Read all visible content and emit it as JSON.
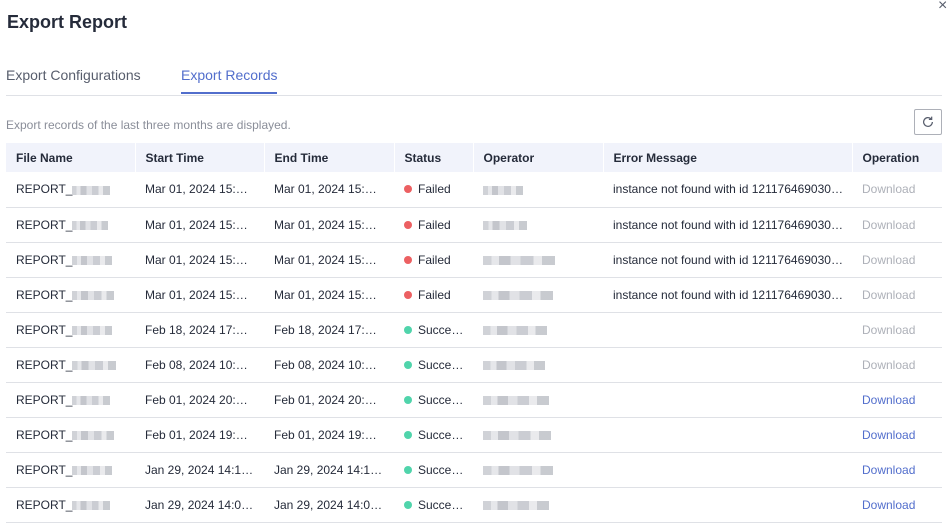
{
  "dialog": {
    "title": "Export Report",
    "close_glyph": "×"
  },
  "tabs": [
    {
      "label": "Export Configurations",
      "active": false
    },
    {
      "label": "Export Records",
      "active": true
    }
  ],
  "notice": "Export records of the last three months are displayed.",
  "refresh_icon": "refresh-icon",
  "colors": {
    "accent": "#526ecc",
    "failed": "#ec6062",
    "success": "#50d4ab",
    "disabled": "#adb0b8"
  },
  "table": {
    "columns": [
      "File Name",
      "Start Time",
      "End Time",
      "Status",
      "Operator",
      "Error Message",
      "Operation"
    ],
    "rows": [
      {
        "file": "REPORT_",
        "start": "Mar 01, 2024 15:…",
        "end": "Mar 01, 2024 15:…",
        "status": "Failed",
        "status_type": "failed",
        "error": "instance not found with id 121176469030…",
        "op": "Download",
        "op_enabled": false
      },
      {
        "file": "REPORT_",
        "start": "Mar 01, 2024 15:…",
        "end": "Mar 01, 2024 15:…",
        "status": "Failed",
        "status_type": "failed",
        "error": "instance not found with id 121176469030…",
        "op": "Download",
        "op_enabled": false
      },
      {
        "file": "REPORT_",
        "start": "Mar 01, 2024 15:…",
        "end": "Mar 01, 2024 15:…",
        "status": "Failed",
        "status_type": "failed",
        "error": "instance not found with id 121176469030…",
        "op": "Download",
        "op_enabled": false
      },
      {
        "file": "REPORT_",
        "start": "Mar 01, 2024 15:…",
        "end": "Mar 01, 2024 15:…",
        "status": "Failed",
        "status_type": "failed",
        "error": "instance not found with id 121176469030…",
        "op": "Download",
        "op_enabled": false
      },
      {
        "file": "REPORT_",
        "start": "Feb 18, 2024 17:…",
        "end": "Feb 18, 2024 17:…",
        "status": "Succe…",
        "status_type": "success",
        "error": "",
        "op": "Download",
        "op_enabled": false
      },
      {
        "file": "REPORT_",
        "start": "Feb 08, 2024 10:…",
        "end": "Feb 08, 2024 10:…",
        "status": "Succe…",
        "status_type": "success",
        "error": "",
        "op": "Download",
        "op_enabled": false
      },
      {
        "file": "REPORT_",
        "start": "Feb 01, 2024 20:…",
        "end": "Feb 01, 2024 20:…",
        "status": "Succe…",
        "status_type": "success",
        "error": "",
        "op": "Download",
        "op_enabled": true
      },
      {
        "file": "REPORT_",
        "start": "Feb 01, 2024 19:…",
        "end": "Feb 01, 2024 19:…",
        "status": "Succe…",
        "status_type": "success",
        "error": "",
        "op": "Download",
        "op_enabled": true
      },
      {
        "file": "REPORT_",
        "start": "Jan 29, 2024 14:1…",
        "end": "Jan 29, 2024 14:1…",
        "status": "Succe…",
        "status_type": "success",
        "error": "",
        "op": "Download",
        "op_enabled": true
      },
      {
        "file": "REPORT_",
        "start": "Jan 29, 2024 14:0…",
        "end": "Jan 29, 2024 14:0…",
        "status": "Succe…",
        "status_type": "success",
        "error": "",
        "op": "Download",
        "op_enabled": true
      }
    ]
  }
}
